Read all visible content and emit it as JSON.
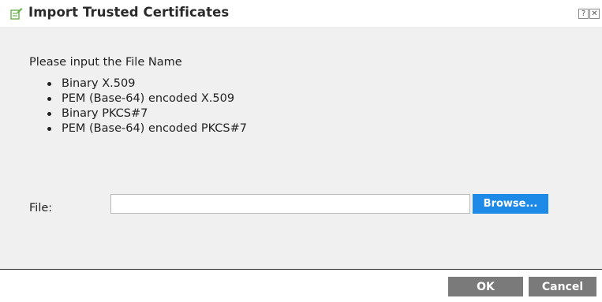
{
  "dialog": {
    "title": "Import Trusted Certificates",
    "title_icon": "certificate-edit-icon",
    "help_label": "?",
    "close_label": "✕"
  },
  "body": {
    "prompt": "Please input the File Name",
    "formats": [
      "Binary X.509",
      "PEM (Base-64) encoded X.509",
      "Binary PKCS#7",
      "PEM (Base-64) encoded PKCS#7"
    ],
    "file_label": "File:",
    "file_value": "",
    "browse_label": "Browse..."
  },
  "footer": {
    "ok_label": "OK",
    "cancel_label": "Cancel"
  },
  "colors": {
    "accent": "#1e8ae8",
    "button_gray": "#7a7a7a",
    "panel_bg": "#f0f0f0",
    "icon_green": "#6ab04c"
  }
}
